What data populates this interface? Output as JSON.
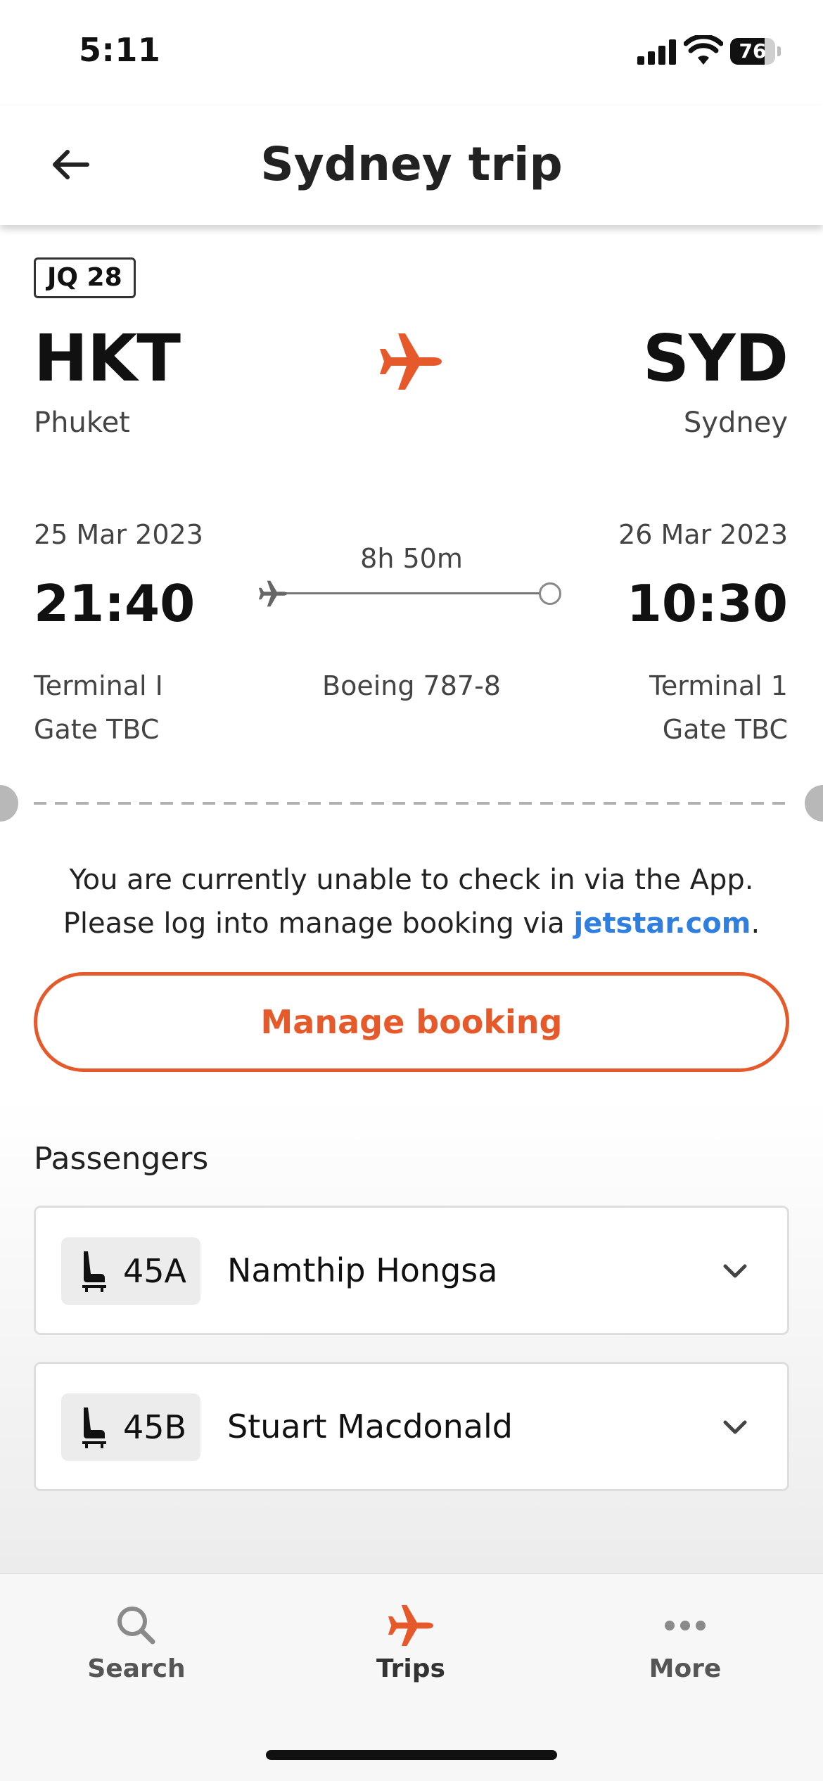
{
  "status_bar": {
    "time": "5:11",
    "battery": "76",
    "battery_level": 0.76
  },
  "header": {
    "title": "Sydney trip",
    "back_icon": "arrow-left-icon"
  },
  "flight": {
    "number": "JQ 28",
    "departure": {
      "code": "HKT",
      "city": "Phuket",
      "date": "25 Mar 2023",
      "time": "21:40",
      "terminal": "Terminal I",
      "gate": "Gate TBC"
    },
    "arrival": {
      "code": "SYD",
      "city": "Sydney",
      "date": "26 Mar 2023",
      "time": "10:30",
      "terminal": "Terminal 1",
      "gate": "Gate TBC"
    },
    "duration": "8h 50m",
    "aircraft": "Boeing 787-8"
  },
  "checkin": {
    "message_before": "You are currently unable to check in via the App. Please log into manage booking via ",
    "link_text": "jetstar.com",
    "message_after": ".",
    "manage_button": "Manage booking"
  },
  "passengers": {
    "title": "Passengers",
    "items": [
      {
        "seat": "45A",
        "name": "Namthip Hongsa"
      },
      {
        "seat": "45B",
        "name": "Stuart Macdonald"
      }
    ]
  },
  "tabbar": {
    "items": [
      {
        "label": "Search",
        "icon": "search-icon"
      },
      {
        "label": "Trips",
        "icon": "plane-icon"
      },
      {
        "label": "More",
        "icon": "more-dots-icon"
      }
    ],
    "active": "Trips"
  },
  "colors": {
    "accent": "#e5592a",
    "link": "#2f7fe0",
    "text": "#1a1a1a"
  }
}
